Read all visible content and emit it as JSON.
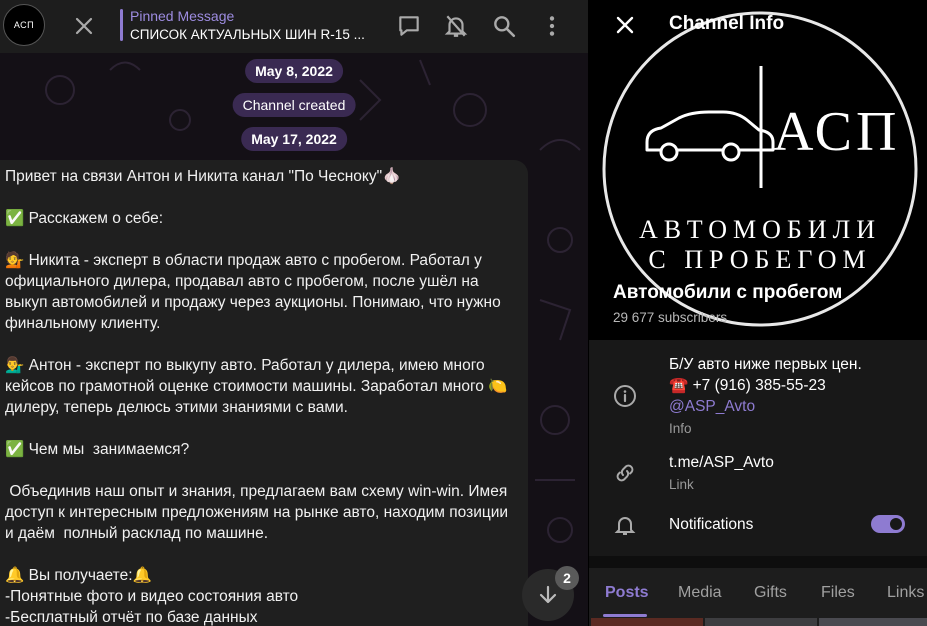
{
  "chat": {
    "avatar_text": "АСП",
    "pinned": {
      "title": "Pinned Message",
      "text": "СПИСОК АКТУАЛЬНЫХ ШИН R-15 ..."
    },
    "dates": [
      "May 8, 2022",
      "Channel created",
      "May 17, 2022"
    ],
    "message_lines": [
      "Привет на связи Антон и Никита канал \"По Чесноку\"🧄",
      "",
      "✅ Расскажем о себе:",
      "",
      "💁 Никита - эксперт в области продаж авто с пробегом. Работал у официального дилера, продавал авто с пробегом, после ушёл на выкуп автомобилей и продажу через аукционы. Понимаю, что нужно финальному клиенту.",
      "",
      "💁‍♂️ Антон - эксперт по выкупу авто. Работал у дилера, имею много кейсов по грамотной оценке стоимости машины. Заработал много 🍋 дилеру, теперь делюсь этими знаниями с вами.",
      "",
      "✅ Чем мы  занимаемся?",
      "",
      " Объединив наш опыт и знания, предлагаем вам схему win-win. Имея доступ к интересным предложениям на рынке авто, находим позиции и даём  полный расклад по машине.",
      "",
      "🔔 Вы получаете:🔔",
      "-Понятные фото и видео состояния авто",
      "-Бесплатный отчёт по базе данных"
    ],
    "unread_count": "2"
  },
  "info": {
    "title": "Channel Info",
    "logo_main": "АСП",
    "logo_line1": "АВТОМОБИЛИ",
    "logo_line2": "С ПРОБЕГОМ",
    "channel_name": "Автомобили с пробегом",
    "subscribers": "29 677 subscribers",
    "description_lines": [
      "Б/У авто ниже первых цен.",
      "☎️  +7 (916) 385-55-23"
    ],
    "description_link": "@ASP_Avto",
    "description_label": "Info",
    "link_value": "t.me/ASP_Avto",
    "link_label": "Link",
    "notifications_label": "Notifications",
    "notifications_on": true,
    "tabs": [
      "Posts",
      "Media",
      "Gifts",
      "Files",
      "Links"
    ],
    "active_tab": "Posts"
  }
}
